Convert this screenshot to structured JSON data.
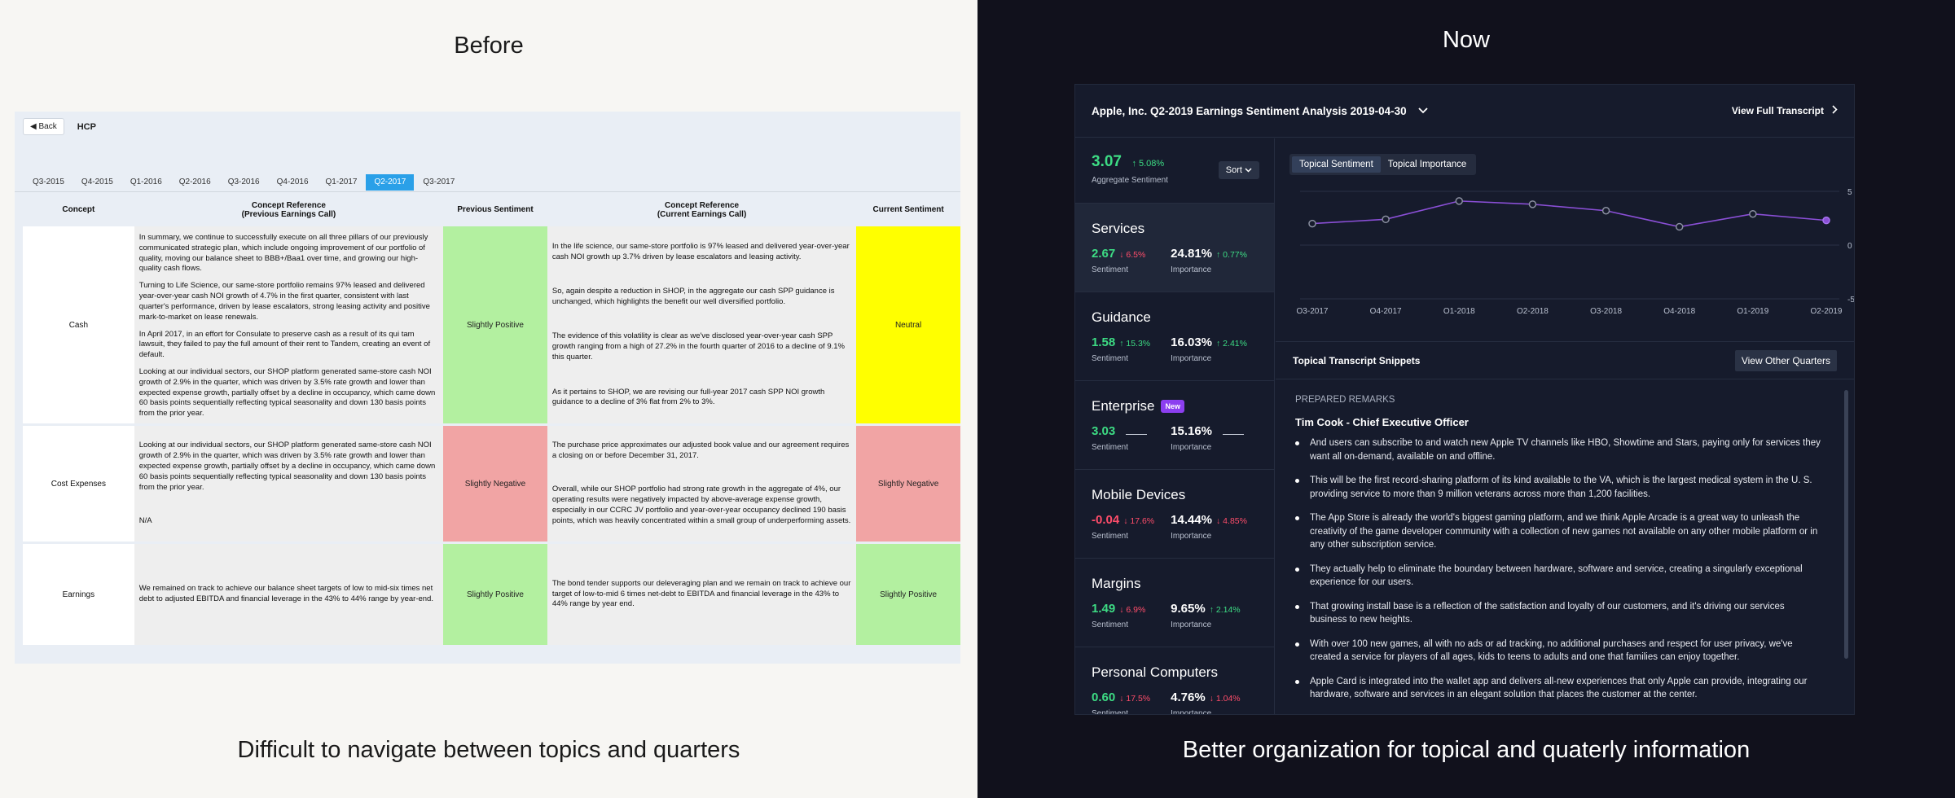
{
  "before": {
    "heading": "Before",
    "caption": "Difficult to navigate between topics and quarters",
    "back_label": "Back",
    "app_label": "HCP",
    "quarters": [
      "Q3-2015",
      "Q4-2015",
      "Q1-2016",
      "Q2-2016",
      "Q3-2016",
      "Q4-2016",
      "Q1-2017",
      "Q2-2017",
      "Q3-2017"
    ],
    "active_quarter": "Q2-2017",
    "columns": {
      "concept": "Concept",
      "prev_ref": "Concept Reference\n(Previous Earnings Call)",
      "prev_sent": "Previous Sentiment",
      "cur_ref": "Concept Reference\n(Current Earnings Call)",
      "cur_sent": "Current Sentiment"
    },
    "rows": [
      {
        "concept": "Cash",
        "prev_refs": [
          "In summary, we continue to successfully execute on all three pillars of our previously communicated strategic plan, which include ongoing improvement of our portfolio of quality, moving our balance sheet to BBB+/Baa1 over time, and growing our high-quality cash flows.",
          "Turning to Life Science, our same-store portfolio remains 97% leased and delivered year-over-year cash NOI growth of 4.7% in the first quarter, consistent with last quarter's performance, driven by lease escalators, strong leasing activity and positive mark-to-market on lease renewals.",
          "In April 2017, in an effort for Consulate to preserve cash as a result of its qui tam lawsuit, they failed to pay the full amount of their rent to Tandem, creating an event of default.",
          "Looking at our individual sectors, our SHOP platform generated same-store cash NOI growth of 2.9% in the quarter, which was driven by 3.5% rate growth and lower than expected expense growth, partially offset by a decline in occupancy, which came down 60 basis points sequentially reflecting typical seasonality and down 130 basis points from the prior year."
        ],
        "prev_sentiment": "Slightly Positive",
        "cur_refs": [
          "In the life science, our same-store portfolio is 97% leased and delivered year-over-year cash NOI growth up 3.7% driven by lease escalators and leasing activity.",
          "So, again despite a reduction in SHOP, in the aggregate our cash SPP guidance is unchanged, which highlights the benefit our well diversified portfolio.",
          "The evidence of this volatility is clear as we've disclosed year-over-year cash SPP growth ranging from a high of 27.2% in the fourth quarter of 2016 to a decline of 9.1% this quarter.",
          "As it pertains to SHOP, we are revising our full-year 2017 cash SPP NOI growth guidance to a decline of 3% flat from 2% to 3%."
        ],
        "cur_sentiment": "Neutral"
      },
      {
        "concept": "Cost Expenses",
        "prev_refs": [
          "Looking at our individual sectors, our SHOP platform generated same-store cash NOI growth of 2.9% in the quarter, which was driven by 3.5% rate growth and lower than expected expense growth, partially offset by a decline in occupancy, which came down 60 basis points sequentially reflecting typical seasonality and down 130 basis points from the prior year.",
          "N/A"
        ],
        "prev_sentiment": "Slightly Negative",
        "cur_refs": [
          "The purchase price approximates our adjusted book value and our agreement requires a closing on or before December 31, 2017.",
          "Overall, while our SHOP portfolio had strong rate growth in the aggregate of 4%, our operating results were negatively impacted by above-average expense growth, especially in our CCRC JV portfolio and year-over-year occupancy declined 190 basis points, which was heavily concentrated within a small group of underperforming assets."
        ],
        "cur_sentiment": "Slightly Negative"
      },
      {
        "concept": "Earnings",
        "prev_refs": [
          "We remained on track to achieve our balance sheet targets of low to mid-six times net debt to adjusted EBITDA and financial leverage in the 43% to 44% range by year-end."
        ],
        "prev_sentiment": "Slightly Positive",
        "cur_refs": [
          "The bond tender supports our deleveraging plan and we remain on track to achieve our target of low-to-mid 6 times net-debt to EBITDA and financial leverage in the 43% to 44% range by year end."
        ],
        "cur_sentiment": "Slightly Positive"
      }
    ],
    "colors": {
      "positive": "#b3f0a0",
      "negative": "#f1a4a4",
      "neutral": "#ffff00",
      "active_tab": "#2aa0e8"
    }
  },
  "now": {
    "heading": "Now",
    "caption": "Better organization for topical and quaterly information",
    "header": {
      "title": "Apple, Inc. Q2-2019 Earnings Sentiment Analysis 2019-04-30",
      "view_full": "View Full Transcript"
    },
    "aggregate": {
      "value": "3.07",
      "delta": "5.08%",
      "label": "Aggregate Sentiment",
      "sort": "Sort"
    },
    "topics": [
      {
        "name": "Services",
        "sentiment": "2.67",
        "sent_delta": "6.5%",
        "sent_dir": "down",
        "importance": "24.81%",
        "imp_delta": "0.77%",
        "imp_dir": "up",
        "active": true
      },
      {
        "name": "Guidance",
        "sentiment": "1.58",
        "sent_delta": "15.3%",
        "sent_dir": "up",
        "importance": "16.03%",
        "imp_delta": "2.41%",
        "imp_dir": "up"
      },
      {
        "name": "Enterprise",
        "badge": "New",
        "sentiment": "3.03",
        "sent_delta": "",
        "sent_dir": "none",
        "importance": "15.16%",
        "imp_delta": "",
        "imp_dir": "none"
      },
      {
        "name": "Mobile Devices",
        "sentiment": "-0.04",
        "sent_delta": "17.6%",
        "sent_dir": "down",
        "importance": "14.44%",
        "imp_delta": "4.85%",
        "imp_dir": "down"
      },
      {
        "name": "Margins",
        "sentiment": "1.49",
        "sent_delta": "6.9%",
        "sent_dir": "down",
        "importance": "9.65%",
        "imp_delta": "2.14%",
        "imp_dir": "up"
      },
      {
        "name": "Personal Computers",
        "sentiment": "0.60",
        "sent_delta": "17.5%",
        "sent_dir": "down",
        "importance": "4.76%",
        "imp_delta": "1.04%",
        "imp_dir": "down"
      }
    ],
    "labels": {
      "sentiment": "Sentiment",
      "importance": "Importance"
    },
    "toggle": [
      "Topical Sentiment",
      "Topical Importance"
    ],
    "snippets": {
      "title": "Topical Transcript Snippets",
      "other_button": "View Other Quarters",
      "section_label": "PREPARED REMARKS",
      "speaker": "Tim Cook - Chief Executive Officer",
      "items": [
        "And users can subscribe to and watch new Apple TV channels like HBO, Showtime and Stars, paying only for services they want all on-demand, available on and offline.",
        "This will be the first record-sharing platform of its kind available to the VA, which is the largest medical system in the U. S. providing service to more than 9 million veterans across more than 1,200 facilities.",
        "The App Store is already the world's biggest gaming platform, and we think Apple Arcade is a great way to unleash the creativity of the game developer community with a collection of new games not available on any other mobile platform or in any other subscription service.",
        "They actually help to eliminate the boundary between hardware, software and service, creating a singularly exceptional experience for our users.",
        "That growing install base is a reflection of the satisfaction and loyalty of our customers, and it's driving our services business to new heights.",
        "With over 100 new games, all with no ads or ad tracking, no additional purchases and respect for user privacy, we've created a service for players of all ages, kids to teens to adults and one that families can enjoy together.",
        "Apple Card is integrated into the wallet app and delivers all-new experiences that only Apple can provide, integrating our hardware, software and services in an elegant solution that places the customer at the center."
      ]
    },
    "colors": {
      "positive": "#3ddc84",
      "negative": "#ff4d6a",
      "line": "#8a4fd6",
      "badge": "#8c3ff0"
    }
  },
  "chart_data": {
    "type": "line",
    "categories": [
      "Q3-2017",
      "Q4-2017",
      "Q1-2018",
      "Q2-2018",
      "Q3-2018",
      "Q4-2018",
      "Q1-2019",
      "Q2-2019"
    ],
    "series": [
      {
        "values": [
          2.0,
          2.4,
          4.1,
          3.8,
          3.2,
          1.7,
          2.9,
          2.3
        ]
      }
    ],
    "yticks": [
      5,
      0,
      -5
    ],
    "ylim": [
      -5,
      5
    ],
    "grid": true
  }
}
